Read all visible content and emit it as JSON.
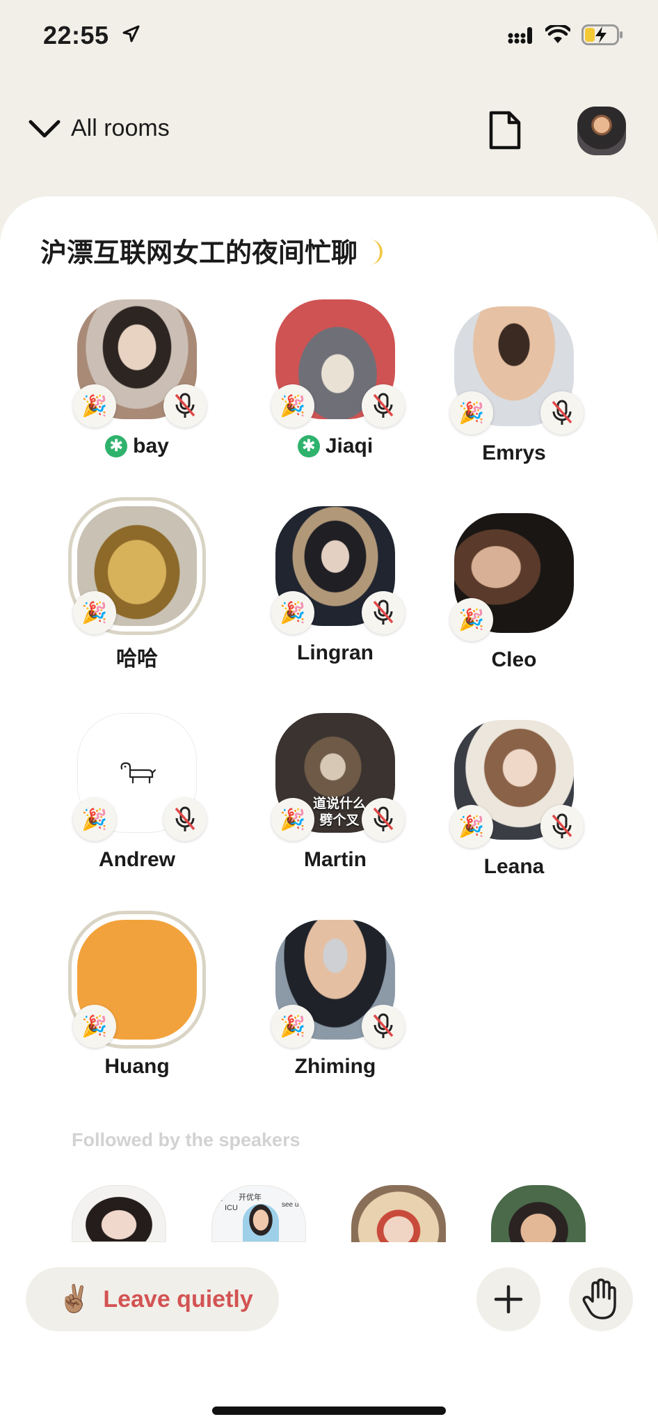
{
  "status_bar": {
    "time": "22:55"
  },
  "header": {
    "all_rooms_label": "All rooms"
  },
  "room": {
    "title": "沪漂互联网女工的夜间忙聊"
  },
  "speakers": [
    {
      "name": "bay",
      "new_user": true,
      "muted": true
    },
    {
      "name": "Jiaqi",
      "new_user": true,
      "muted": true
    },
    {
      "name": "Emrys",
      "new_user": false,
      "muted": true
    },
    {
      "name": "哈哈",
      "new_user": false,
      "muted": false,
      "moderator": true
    },
    {
      "name": "Lingran",
      "new_user": false,
      "muted": true
    },
    {
      "name": "Cleo",
      "new_user": false,
      "muted": false
    },
    {
      "name": "Andrew",
      "new_user": false,
      "muted": true
    },
    {
      "name": "Martin",
      "new_user": false,
      "muted": true,
      "avatar_text": [
        "道说什么",
        "劈个叉"
      ]
    },
    {
      "name": "Leana",
      "new_user": false,
      "muted": true
    },
    {
      "name": "Huang",
      "new_user": false,
      "muted": false,
      "moderator": true
    },
    {
      "name": "Zhiming",
      "new_user": false,
      "muted": true
    }
  ],
  "followed_section": {
    "label": "Followed by the speakers",
    "avatar_texts": {
      "second": [
        "开优年",
        "ICU",
        "ou",
        "see u"
      ]
    }
  },
  "bottom_bar": {
    "leave_label": "Leave quietly"
  },
  "colors": {
    "leave_text": "#d35353",
    "new_user_badge": "#2fb26c",
    "background": "#f1efe7",
    "card": "#ffffff"
  },
  "icons": [
    "location-arrow-icon",
    "signal-icon",
    "wifi-icon",
    "battery-charging-icon",
    "chevron-down-icon",
    "document-icon",
    "party-popper-icon",
    "mic-off-icon",
    "plus-icon",
    "raise-hand-icon",
    "victory-hand-icon",
    "moon-icon"
  ]
}
